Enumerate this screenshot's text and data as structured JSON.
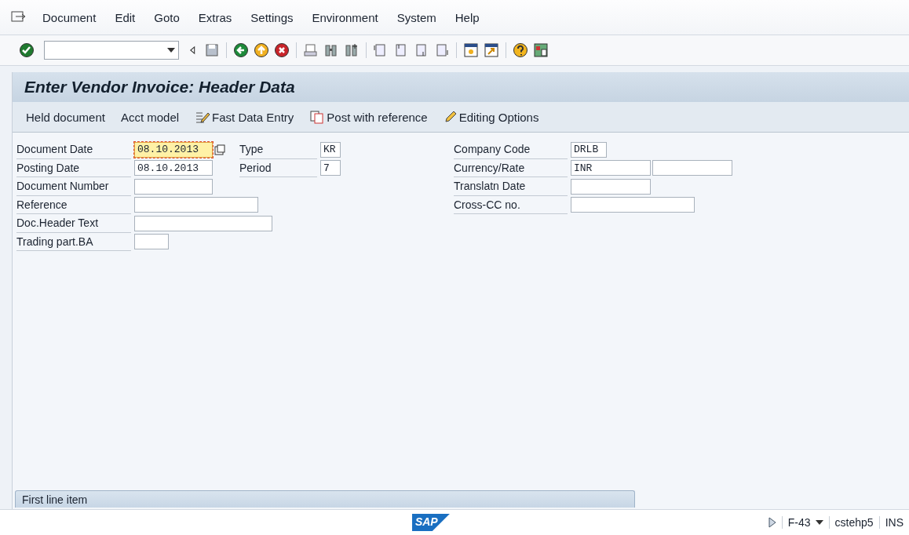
{
  "menu": [
    "Document",
    "Edit",
    "Goto",
    "Extras",
    "Settings",
    "Environment",
    "System",
    "Help"
  ],
  "title": "Enter Vendor Invoice: Header Data",
  "app_toolbar": [
    {
      "label": "Held document",
      "kind": "text"
    },
    {
      "label": "Acct model",
      "kind": "text"
    },
    {
      "label": "Fast Data Entry",
      "kind": "fast"
    },
    {
      "label": "Post with reference",
      "kind": "copy"
    },
    {
      "label": "Editing Options",
      "kind": "pencil"
    }
  ],
  "left_fields": [
    {
      "label": "Document Date",
      "value": "08.10.2013",
      "focused": true
    },
    {
      "label": "Posting Date",
      "value": "08.10.2013",
      "focused": false
    },
    {
      "label": "Document Number",
      "focused": false
    },
    {
      "label": "Reference",
      "focused": false
    },
    {
      "label": "Doc.Header Text",
      "focused": false
    },
    {
      "label": "Trading part.BA",
      "focused": false
    }
  ],
  "middle_fields": [
    {
      "label": "Type",
      "value": "KR"
    },
    {
      "label": "Period",
      "value": "7"
    }
  ],
  "right_fields": [
    {
      "label": "Company Code",
      "value": "DRLB"
    },
    {
      "label": "Currency/Rate",
      "value": "INR",
      "extra_field": true
    },
    {
      "label": "Translatn Date"
    },
    {
      "label": "Cross-CC no."
    }
  ],
  "section": {
    "title": "First line item"
  },
  "status_bar": {
    "logo": "SAP",
    "transaction": "F-43",
    "server": "cstehp5",
    "mode": "INS"
  }
}
